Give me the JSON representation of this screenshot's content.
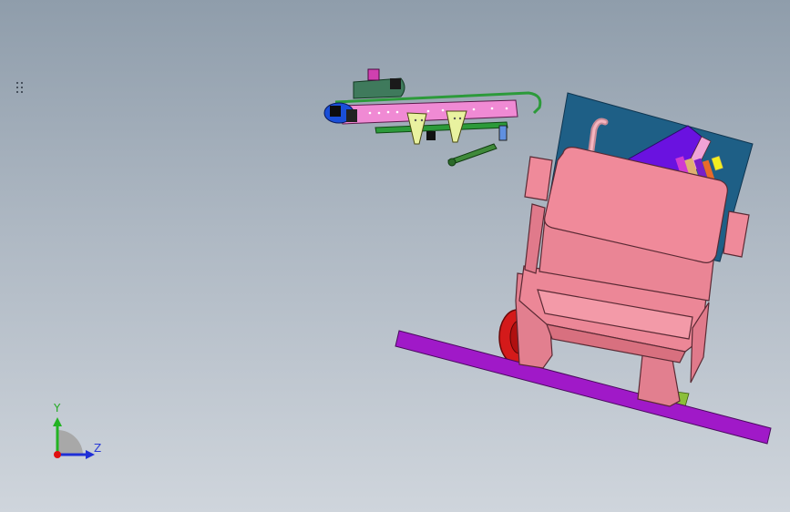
{
  "triad": {
    "y_label": "Y",
    "z_label": "Z",
    "colors": {
      "y": "#23b323",
      "z": "#1f2fd6",
      "x": "#e01010",
      "arc": "#a8a8a8"
    }
  },
  "colors": {
    "background_top": "#8f9dab",
    "background_bottom": "#cfd5dc",
    "cab": "#ef8c9c",
    "cab_edge": "#5a2a34",
    "board": "#1e5f86",
    "ground_bar": "#a019c8",
    "purple_part": "#6a12e0",
    "arm_green": "#3f7a5c",
    "arm_pink": "#f08ad4",
    "rod_green": "#2c9a3a",
    "clip_yellow": "#e9f2a0",
    "blue_hub": "#1a4fd8",
    "wheel_red": "#d41a1a"
  },
  "icons": [
    "panel-grip-icon",
    "coordinate-triad-icon"
  ]
}
